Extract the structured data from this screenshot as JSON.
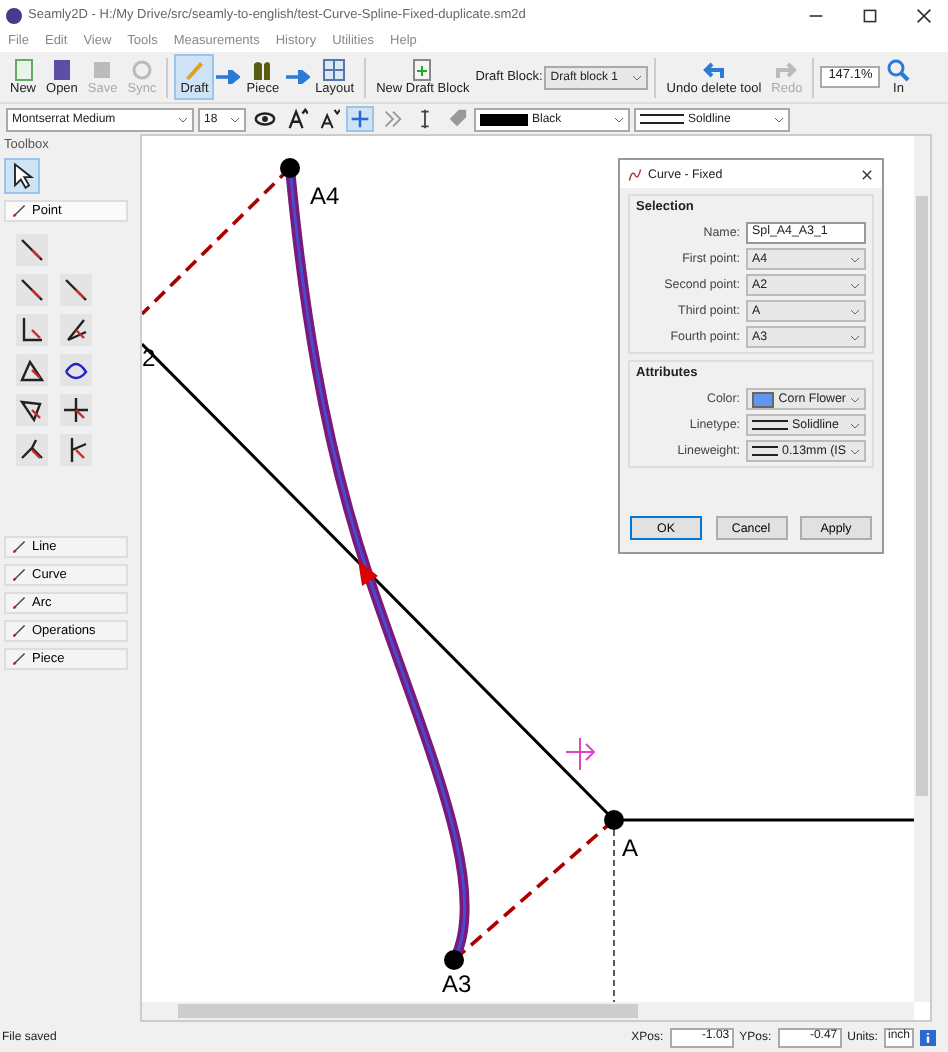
{
  "window": {
    "title": "Seamly2D - H:/My Drive/src/seamly-to-english/test-Curve-Spline-Fixed-duplicate.sm2d"
  },
  "menu": [
    "File",
    "Edit",
    "View",
    "Tools",
    "Measurements",
    "History",
    "Utilities",
    "Help"
  ],
  "file_tools": [
    {
      "label": "New",
      "disabled": false
    },
    {
      "label": "Open",
      "disabled": false
    },
    {
      "label": "Save",
      "disabled": true
    },
    {
      "label": "Sync",
      "disabled": true
    }
  ],
  "modes": [
    {
      "label": "Draft",
      "selected": true
    },
    {
      "label": "Piece",
      "selected": false
    },
    {
      "label": "Layout",
      "selected": false
    }
  ],
  "draft_block": {
    "button": "New Draft Block",
    "label": "Draft Block:",
    "value": "Draft block 1"
  },
  "history": [
    {
      "label": "Undo delete tool",
      "disabled": false
    },
    {
      "label": "Redo",
      "disabled": true
    }
  ],
  "zoom": {
    "value": "147.1%",
    "button": "In"
  },
  "format_bar": {
    "font": "Montserrat Medium",
    "size": "18",
    "tools": [
      {
        "selected": false
      },
      {
        "selected": false
      },
      {
        "selected": false
      },
      {
        "selected": true
      },
      {
        "selected": false
      },
      {
        "selected": false
      },
      {
        "selected": false
      }
    ],
    "color_name": "Black",
    "linetype": "Soldline"
  },
  "toolbox": {
    "title": "Toolbox",
    "select_tool": {
      "selected": true
    },
    "sections": [
      {
        "label": "Point",
        "expanded": true
      },
      {
        "label": "Line",
        "expanded": false
      },
      {
        "label": "Curve",
        "expanded": false
      },
      {
        "label": "Arc",
        "expanded": false
      },
      {
        "label": "Operations",
        "expanded": false
      },
      {
        "label": "Piece",
        "expanded": false
      }
    ]
  },
  "canvas": {
    "points": [
      {
        "label": "A4"
      },
      {
        "label": "2"
      },
      {
        "label": "A"
      },
      {
        "label": "A3"
      }
    ]
  },
  "dialog": {
    "title": "Curve - Fixed",
    "selection": {
      "heading": "Selection",
      "name_label": "Name:",
      "name": "Spl_A4_A3_1",
      "fields": [
        {
          "label": "First point:",
          "value": "A4"
        },
        {
          "label": "Second point:",
          "value": "A2"
        },
        {
          "label": "Third point:",
          "value": "A"
        },
        {
          "label": "Fourth point:",
          "value": "A3"
        }
      ]
    },
    "attributes": {
      "heading": "Attributes",
      "color_label": "Color:",
      "color_name": "Corn Flower",
      "color": "#6495ed",
      "linetype_label": "Linetype:",
      "linetype": "Solidline",
      "lineweight_label": "Lineweight:",
      "lineweight": "0.13mm (IS"
    },
    "buttons": [
      "OK",
      "Cancel",
      "Apply"
    ]
  },
  "status_bar": {
    "message": "File saved",
    "xpos_label": "XPos:",
    "xpos": "-1.03",
    "ypos_label": "YPos:",
    "ypos": "-0.47",
    "units_label": "Units:",
    "units": "inch"
  }
}
